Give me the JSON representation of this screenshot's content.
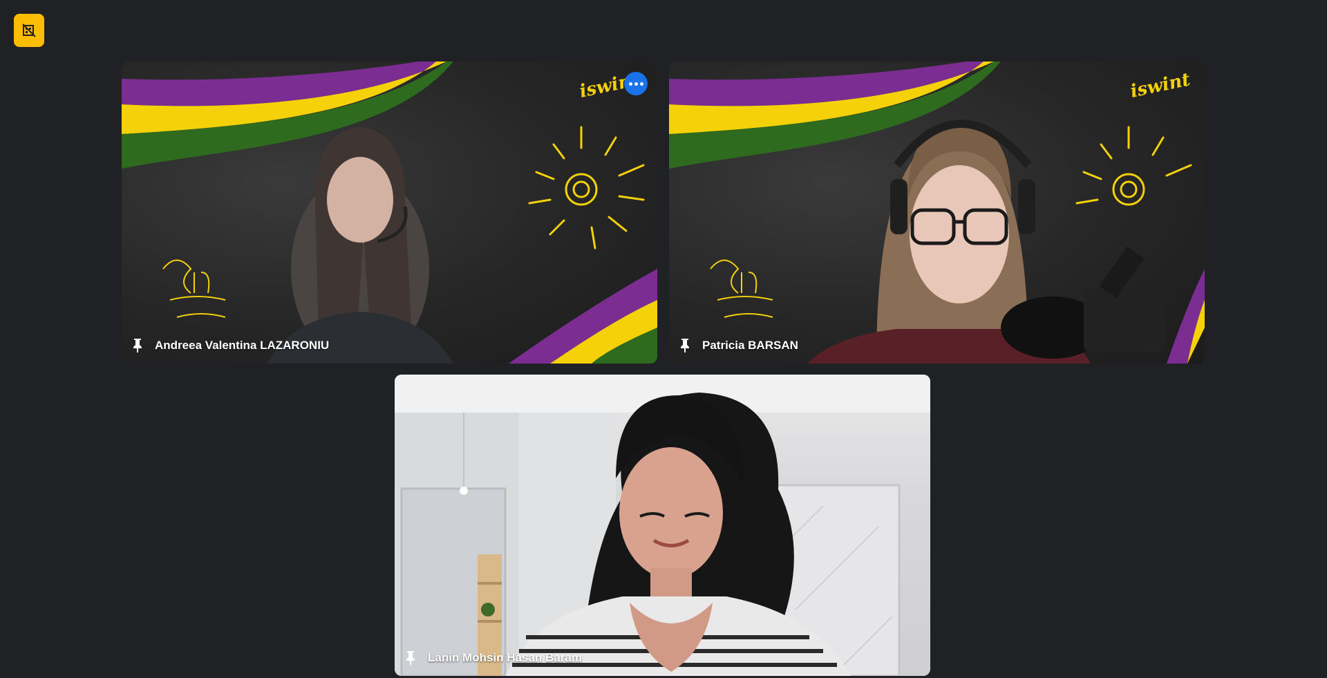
{
  "participants": [
    {
      "name": "Andreea Valentina LAZARONIU",
      "has_more_options": true,
      "background": "iswint-chalkboard"
    },
    {
      "name": "Patricia BARSAN",
      "has_more_options": false,
      "background": "iswint-chalkboard"
    },
    {
      "name": "Lanin Mohsin Hasan Baram",
      "has_more_options": false,
      "background": "room"
    }
  ],
  "background_logo_text": "iswint",
  "icons": {
    "corner_button": "background-blur-off-icon",
    "pin": "pin-icon",
    "more": "more-options-icon"
  },
  "colors": {
    "page_background": "#202124",
    "corner_button": "#fbbc04",
    "more_button": "#1a73e8",
    "stripe_purple": "#7b2d91",
    "stripe_yellow": "#f5d10a",
    "stripe_green": "#2e6b1f"
  }
}
